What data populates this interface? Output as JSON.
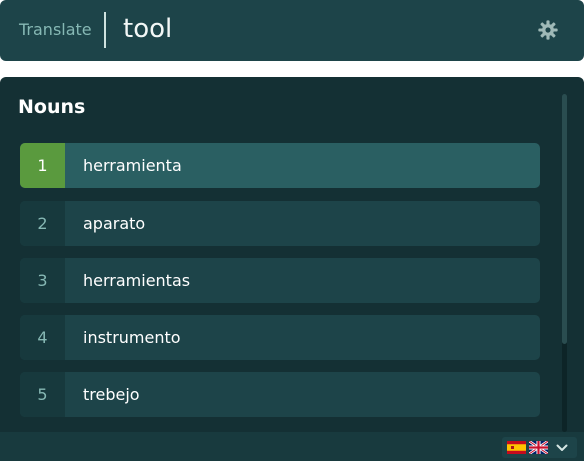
{
  "header": {
    "label": "Translate",
    "query": "tool"
  },
  "results": {
    "heading": "Nouns",
    "items": [
      {
        "number": "1",
        "word": "herramienta",
        "selected": true
      },
      {
        "number": "2",
        "word": "aparato",
        "selected": false
      },
      {
        "number": "3",
        "word": "herramientas",
        "selected": false
      },
      {
        "number": "4",
        "word": "instrumento",
        "selected": false
      },
      {
        "number": "5",
        "word": "trebejo",
        "selected": false
      }
    ]
  },
  "language_switch": {
    "source_flag": "spain-flag-icon",
    "target_flag": "uk-flag-icon",
    "toggle_icon": "chevron-down-icon"
  },
  "colors": {
    "background": "#143034",
    "bar": "#1d4449",
    "selected_row": "#2a5f62",
    "accent_green": "#5a9a3e",
    "muted_text": "#86b8b4"
  }
}
